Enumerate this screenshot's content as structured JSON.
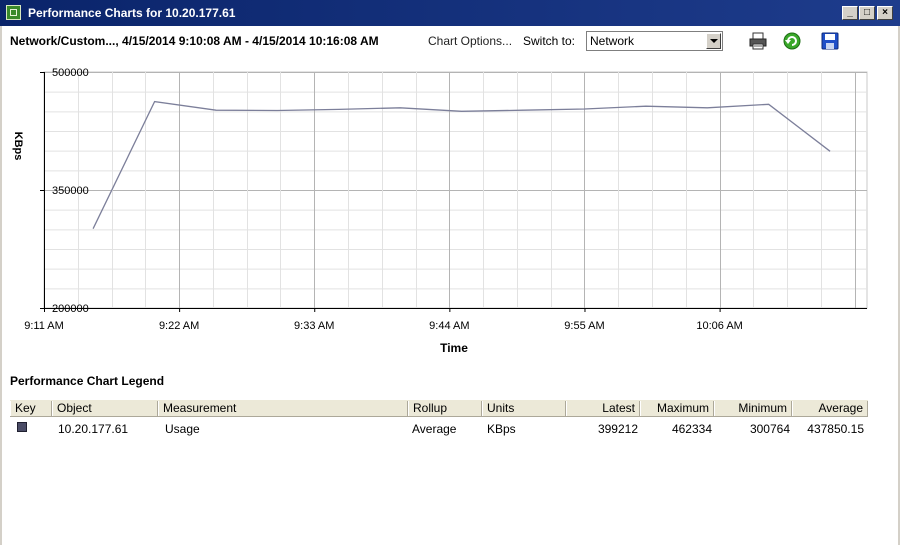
{
  "window": {
    "title": "Performance Charts for 10.20.177.61",
    "controls": [
      "_",
      "□",
      "×"
    ]
  },
  "toolbar": {
    "chart_title": "Network/Custom..., 4/15/2014 9:10:08 AM - 4/15/2014 10:16:08 AM",
    "chart_options_label": "Chart Options...",
    "switch_to_label": "Switch to:",
    "switch_to_value": "Network",
    "icons": [
      "print-icon",
      "refresh-icon",
      "save-icon"
    ]
  },
  "chart_data": {
    "type": "line",
    "title": "",
    "xlabel": "Time",
    "ylabel": "KBps",
    "ylim": [
      200000,
      500000
    ],
    "yticks": [
      "500000",
      "350000",
      "200000"
    ],
    "xticks": [
      "9:11 AM",
      "9:22 AM",
      "9:33 AM",
      "9:44 AM",
      "9:55 AM",
      "10:06 AM"
    ],
    "x_minutes_after_9am": [
      15,
      20,
      25,
      30,
      35,
      40,
      45,
      50,
      55,
      60,
      65,
      70
    ],
    "series": [
      {
        "color": "#7c7f9a",
        "values": [
          300764,
          462334,
          451500,
          451000,
          452500,
          454500,
          450000,
          451500,
          453000,
          456500,
          454500,
          459000,
          399212
        ]
      }
    ]
  },
  "legend": {
    "title": "Performance Chart Legend",
    "columns": [
      "Key",
      "Object",
      "Measurement",
      "Rollup",
      "Units",
      "Latest",
      "Maximum",
      "Minimum",
      "Average"
    ],
    "rows": [
      {
        "key_color": "#4a4c66",
        "object": "10.20.177.61",
        "measurement": "Usage",
        "rollup": "Average",
        "units": "KBps",
        "latest": "399212",
        "maximum": "462334",
        "minimum": "300764",
        "average": "437850.15"
      }
    ]
  }
}
